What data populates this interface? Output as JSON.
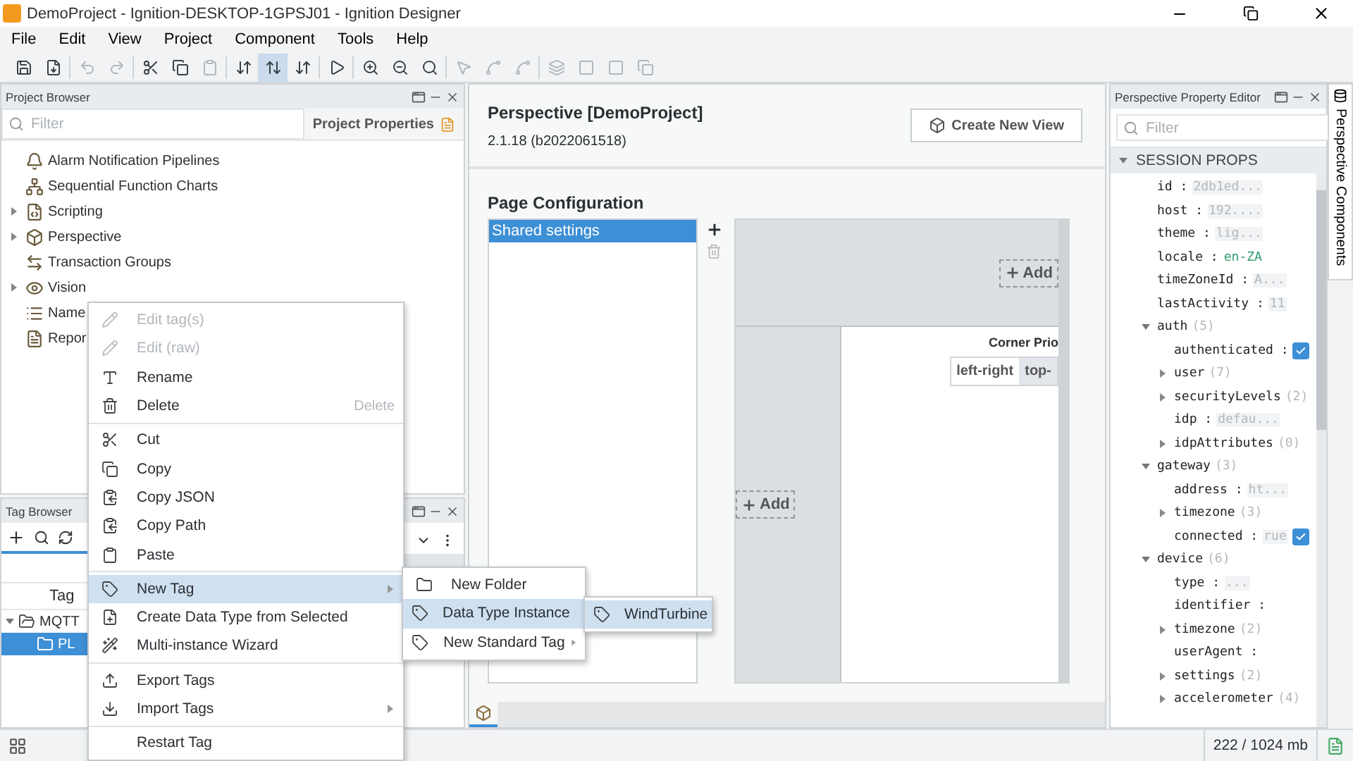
{
  "window": {
    "title": "DemoProject - Ignition-DESKTOP-1GPSJ01 - Ignition Designer"
  },
  "menu_bar": [
    "File",
    "Edit",
    "View",
    "Project",
    "Component",
    "Tools",
    "Help"
  ],
  "toolbar": [
    {
      "selected": false,
      "disabled": false
    },
    {
      "selected": false,
      "disabled": false
    },
    {
      "selected": false,
      "disabled": true
    },
    {
      "selected": false,
      "disabled": true
    },
    {
      "selected": false,
      "disabled": false
    },
    {
      "selected": false,
      "disabled": false
    },
    {
      "selected": false,
      "disabled": true
    },
    {
      "selected": false,
      "disabled": false
    },
    {
      "selected": true,
      "disabled": false
    },
    {
      "selected": false,
      "disabled": false
    },
    {
      "selected": false,
      "disabled": false
    },
    {
      "selected": false,
      "disabled": false
    },
    {
      "selected": false,
      "disabled": false
    },
    {
      "selected": false,
      "disabled": false
    },
    {
      "selected": false,
      "disabled": true
    },
    {
      "selected": false,
      "disabled": true
    },
    {
      "selected": false,
      "disabled": true
    },
    {
      "selected": false,
      "disabled": true
    },
    {
      "selected": false,
      "disabled": true
    },
    {
      "selected": false,
      "disabled": true
    },
    {
      "selected": false,
      "disabled": true
    }
  ],
  "project_browser": {
    "title": "Project Browser",
    "filter": {
      "placeholder": "Filter"
    },
    "properties_button": "Project Properties",
    "items": [
      {
        "label": "Alarm Notification Pipelines",
        "kind": "leaf"
      },
      {
        "label": "Sequential Function Charts",
        "kind": "leaf"
      },
      {
        "label": "Scripting",
        "kind": "group",
        "expanded": false
      },
      {
        "label": "Perspective",
        "kind": "group",
        "expanded": false
      },
      {
        "label": "Transaction Groups",
        "kind": "leaf"
      },
      {
        "label": "Vision",
        "kind": "group",
        "expanded": false
      },
      {
        "label": "Name",
        "kind": "leaf"
      },
      {
        "label": "Repor",
        "kind": "leaf"
      }
    ]
  },
  "tag_browser": {
    "title": "Tag Browser",
    "column": "Tag",
    "rows": [
      {
        "label": "MQTT",
        "selected": false,
        "expanded": true,
        "children": [
          {
            "label": "PL",
            "selected": true
          }
        ]
      }
    ]
  },
  "center": {
    "title": "Perspective [DemoProject]",
    "version": "2.1.18 (b2022061518)",
    "create_button": "Create New View",
    "section": "Page Configuration",
    "pages": [
      {
        "label": "Shared settings",
        "selected": true
      }
    ],
    "add_buttons": [
      "Add",
      "Add"
    ],
    "corner_label": "Corner Prio",
    "corner_options": [
      {
        "label": "left-right",
        "selected": false
      },
      {
        "label": "top-",
        "selected": true
      }
    ],
    "view_tabs": [
      {
        "selected": true
      }
    ]
  },
  "property_editor": {
    "title": "Perspective Property Editor",
    "filter": {
      "placeholder": "Filter"
    },
    "section": "SESSION PROPS",
    "section_expanded": true,
    "rows": [
      {
        "name": "id :",
        "value": "2db1ed..."
      },
      {
        "name": "host :",
        "value": "192...."
      },
      {
        "name": "theme :",
        "value": "lig..."
      },
      {
        "name": "locale :",
        "value": "en-ZA",
        "kind": "locale"
      },
      {
        "name": "timeZoneId :",
        "value": "A..."
      },
      {
        "name": "lastActivity :",
        "value": "11"
      },
      {
        "name": "auth",
        "count": "(5)",
        "expanded": true,
        "children": [
          {
            "name": "authenticated :",
            "checked": true
          },
          {
            "name": "user",
            "count": "(7)",
            "expanded": false
          },
          {
            "name": "securityLevels",
            "count": "(2)",
            "expanded": false
          },
          {
            "name": "idp :",
            "value": "defau..."
          },
          {
            "name": "idpAttributes",
            "count": "(0)",
            "expanded": false
          }
        ]
      },
      {
        "name": "gateway",
        "count": "(3)",
        "expanded": true,
        "children": [
          {
            "name": "address :",
            "value": "ht..."
          },
          {
            "name": "timezone",
            "count": "(3)",
            "expanded": false
          },
          {
            "name": "connected :",
            "value": "rue",
            "checked": true
          }
        ]
      },
      {
        "name": "device",
        "count": "(6)",
        "expanded": true,
        "children": [
          {
            "name": "type :",
            "value": "..."
          },
          {
            "name": "identifier :"
          },
          {
            "name": "timezone",
            "count": "(2)",
            "expanded": false
          },
          {
            "name": "userAgent :"
          },
          {
            "name": "settings",
            "count": "(2)",
            "expanded": false
          },
          {
            "name": "accelerometer",
            "count": "(4)",
            "expanded": false
          }
        ]
      }
    ]
  },
  "side_tab": "Perspective Components",
  "context_menu": {
    "groups": [
      [
        {
          "label": "Edit tag(s)",
          "disabled": true
        },
        {
          "label": "Edit (raw)",
          "disabled": true
        },
        {
          "label": "Rename",
          "disabled": false
        },
        {
          "label": "Delete",
          "disabled": false,
          "shortcut": "Delete"
        }
      ],
      [
        {
          "label": "Cut",
          "disabled": false
        },
        {
          "label": "Copy",
          "disabled": false
        },
        {
          "label": "Copy JSON",
          "disabled": false
        },
        {
          "label": "Copy Path",
          "disabled": false
        },
        {
          "label": "Paste",
          "disabled": false
        }
      ],
      [
        {
          "label": "New Tag",
          "disabled": false,
          "selected": true,
          "submenu": true
        },
        {
          "label": "Create Data Type from Selected",
          "disabled": false
        },
        {
          "label": "Multi-instance Wizard",
          "disabled": false
        }
      ],
      [
        {
          "label": "Export Tags",
          "disabled": false
        },
        {
          "label": "Import Tags",
          "disabled": false,
          "submenu": true
        }
      ],
      [
        {
          "label": "Restart Tag",
          "disabled": false
        }
      ]
    ]
  },
  "submenu": [
    {
      "label": "New Folder",
      "selected": false
    },
    {
      "label": "Data Type Instance",
      "selected": true,
      "submenu": true
    },
    {
      "label": "New Standard Tag",
      "selected": false,
      "submenu": true
    }
  ],
  "submenu_2": [
    {
      "label": "WindTurbine",
      "selected": true
    }
  ],
  "status_bar": {
    "memory": "222 / 1024 mb"
  }
}
